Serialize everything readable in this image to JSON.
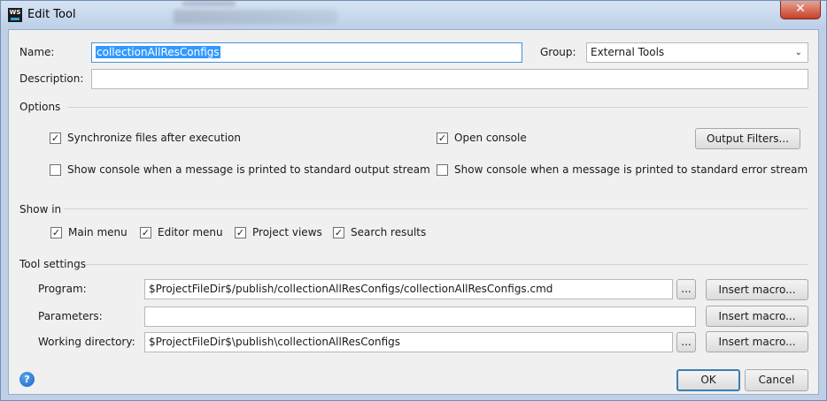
{
  "window": {
    "title": "Edit Tool",
    "close_glyph": "✕",
    "app_icon_text": "WS"
  },
  "form": {
    "name_label": "Name:",
    "name_value": "collectionAllResConfigs",
    "group_label": "Group:",
    "group_value": "External Tools",
    "description_label": "Description:",
    "description_value": ""
  },
  "options": {
    "title": "Options",
    "sync_files": {
      "label": "Synchronize files after execution",
      "checked": true
    },
    "open_console": {
      "label": "Open console",
      "checked": true
    },
    "output_filters_button": "Output Filters...",
    "show_console_stdout": {
      "label": "Show console when a message is printed to standard output stream",
      "checked": false
    },
    "show_console_stderr": {
      "label": "Show console when a message is printed to standard error stream",
      "checked": false
    }
  },
  "show_in": {
    "title": "Show in",
    "items": [
      {
        "label": "Main menu",
        "checked": true
      },
      {
        "label": "Editor menu",
        "checked": true
      },
      {
        "label": "Project views",
        "checked": true
      },
      {
        "label": "Search results",
        "checked": true
      }
    ]
  },
  "tool_settings": {
    "title": "Tool settings",
    "program_label": "Program:",
    "program_value": "$ProjectFileDir$/publish/collectionAllResConfigs/collectionAllResConfigs.cmd",
    "parameters_label": "Parameters:",
    "parameters_value": "",
    "working_dir_label": "Working directory:",
    "working_dir_value": "$ProjectFileDir$\\publish\\collectionAllResConfigs",
    "browse_label": "...",
    "insert_macro_label": "Insert macro..."
  },
  "footer": {
    "help_glyph": "?",
    "ok_label": "OK",
    "cancel_label": "Cancel"
  },
  "colors": {
    "selection": "#3399ff",
    "focus_border": "#4a90d9",
    "close_button": "#c7402a",
    "default_button_border": "#3c7fb1"
  }
}
